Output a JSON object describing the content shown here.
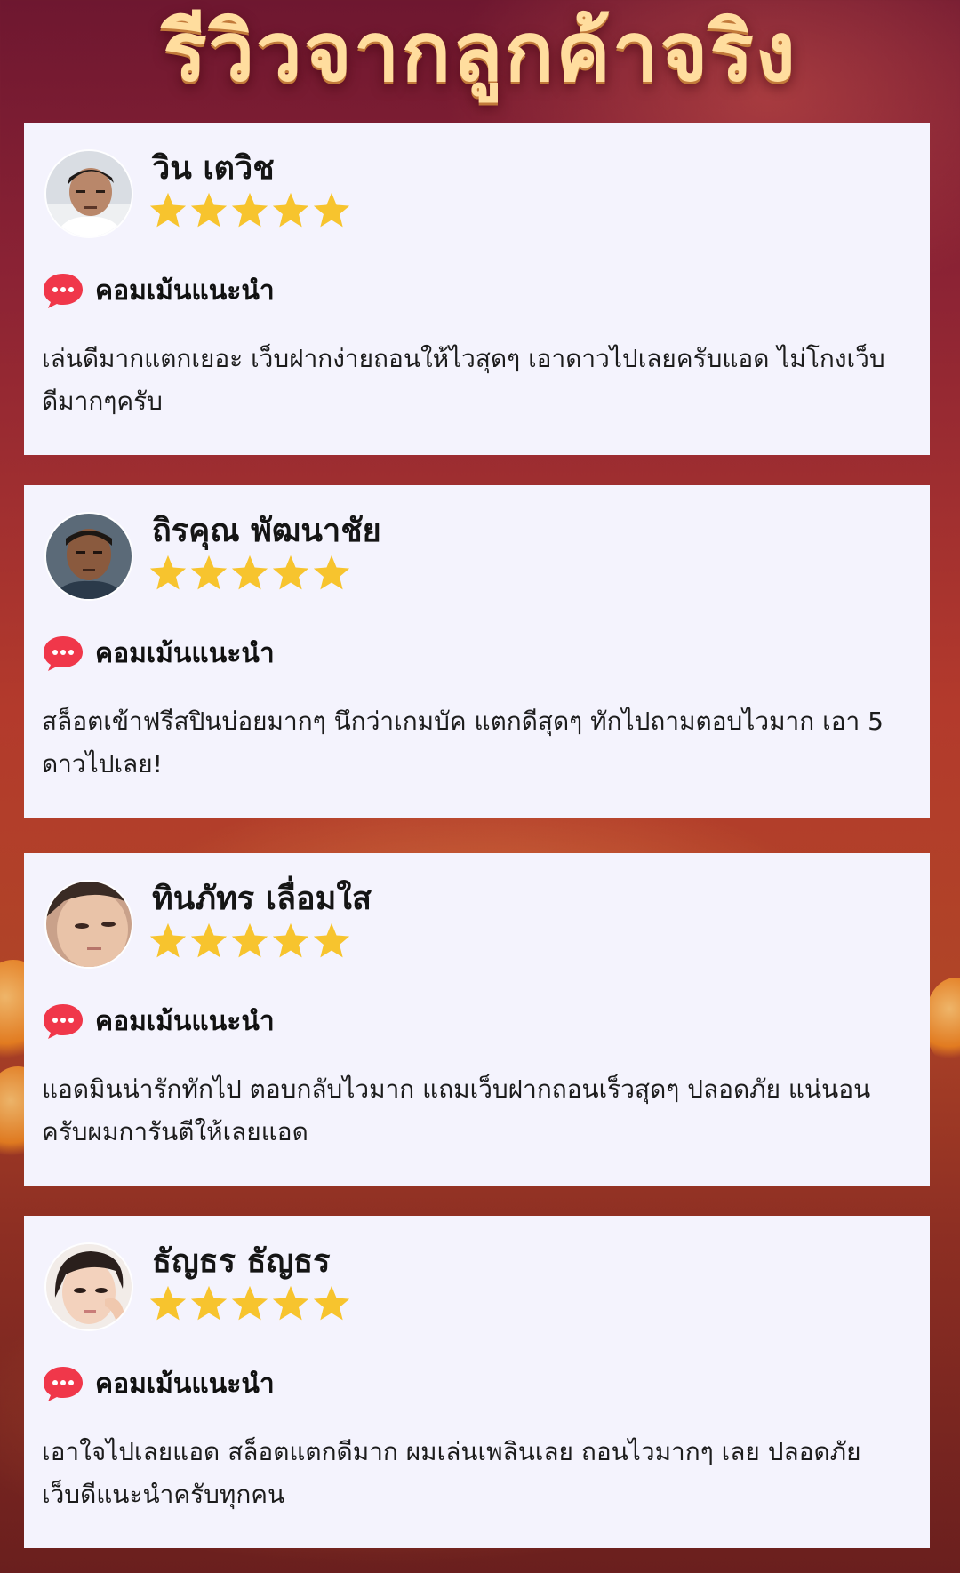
{
  "title": "รีวิวจากลูกค้าจริง",
  "comment_label": "คอมเม้นแนะนำ",
  "star_color": "#f7c42e",
  "chat_icon_color": "#f0374a",
  "reviews": [
    {
      "name": "วิน เตวิช",
      "rating": 5,
      "avatar": "avatar-man-cap-icon",
      "text": "เล่นดีมากแตกเยอะ เว็บฝากง่ายถอนให้ไวสุดๆ เอาดาวไปเลยครับแอด ไม่โกงเว็บดีมากๆครับ"
    },
    {
      "name": "ถิรคุณ พัฒนาชัย",
      "rating": 5,
      "avatar": "avatar-man-icon",
      "text": "สล็อตเข้าฟรีสปินบ่อยมากๆ นึกว่าเกมบัค แตกดีสุดๆ ทักไปถามตอบไวมาก เอา 5 ดาวไปเลย!"
    },
    {
      "name": "ทินภัทร เลื่อมใส",
      "rating": 5,
      "avatar": "avatar-face-closeup-icon",
      "text": "แอดมินน่ารักทักไป ตอบกลับไวมาก แถมเว็บฝากถอนเร็วสุดๆ ปลอดภัย แน่นอนครับผมการันตีให้เลยแอด"
    },
    {
      "name": "ธัญธร ธัญธร",
      "rating": 5,
      "avatar": "avatar-woman-icon",
      "text": "เอาใจไปเลยแอด สล็อตแตกดีมาก ผมเล่นเพลินเลย ถอนไวมากๆ เลย ปลอดภัย เว็บดีแนะนำครับทุกคน"
    }
  ]
}
